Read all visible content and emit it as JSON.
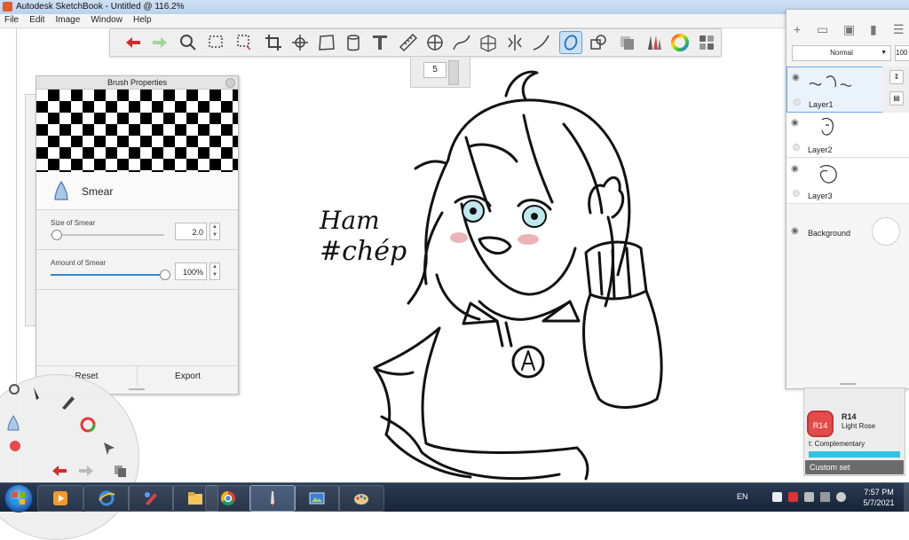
{
  "window": {
    "title": "Autodesk SketchBook - Untitled @ 116.2%"
  },
  "menu": [
    "File",
    "Edit",
    "Image",
    "Window",
    "Help"
  ],
  "toolbar": {
    "tools": [
      "undo-icon",
      "redo-icon",
      "zoom-icon",
      "select-rect-icon",
      "select-lasso-icon",
      "crop-icon",
      "transform-icon",
      "distort-icon",
      "fill-icon",
      "text-icon",
      "ruler-icon",
      "ellipse-guide-icon",
      "curve-ruler-icon",
      "perspective-icon",
      "symmetry-icon",
      "stroke-icon",
      "predictive-stroke-icon",
      "shapes-icon",
      "copic-icon",
      "brush-library-icon",
      "color-wheel-icon",
      "layers-icon"
    ],
    "active_tool": "predictive-stroke-icon",
    "brush_size": "5"
  },
  "brush_properties": {
    "title": "Brush Properties",
    "brush_name": "Smear",
    "size_label": "Size of Smear",
    "size_value": "2.0",
    "size_fraction": 0.05,
    "amount_label": "Amount of Smear",
    "amount_value": "100%",
    "amount_fraction": 1.0,
    "reset_label": "Reset",
    "export_label": "Export"
  },
  "layers": {
    "blend_mode": "Normal",
    "opacity": "100",
    "items": [
      {
        "name": "Layer1",
        "selected": true
      },
      {
        "name": "Layer2",
        "selected": false
      },
      {
        "name": "Layer3",
        "selected": false
      }
    ],
    "background_label": "Background"
  },
  "color": {
    "code": "R14",
    "name": "Light Rose",
    "complementary_label": "t: Complementary",
    "custom_set_label": "Custom set",
    "swatch_color": "#e54b4b",
    "complement_color": "#2ec4e2"
  },
  "canvas_text": {
    "line1": "Ham",
    "line2": "#chép"
  },
  "taskbar": {
    "apps": [
      "media-player-icon",
      "internet-explorer-icon",
      "paint-icon",
      "file-explorer-icon",
      "chrome-icon",
      "sketchbook-icon",
      "photo-viewer-icon",
      "paint-palette-icon"
    ],
    "language": "EN",
    "time": "7:57 PM",
    "date": "5/7/2021"
  }
}
